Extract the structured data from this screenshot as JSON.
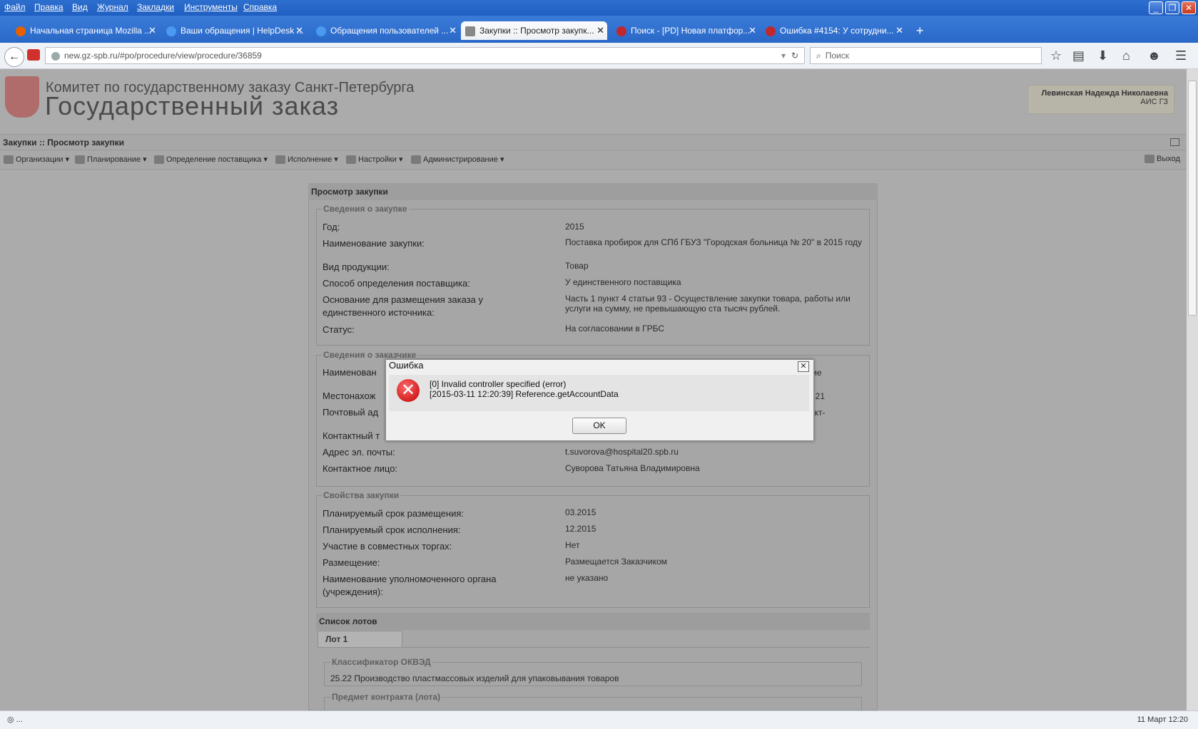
{
  "menu": [
    "Файл",
    "Правка",
    "Вид",
    "Журнал",
    "Закладки",
    "Инструменты",
    "Справка"
  ],
  "tabs": [
    {
      "label": "Начальная страница Mozilla ...",
      "icon": "firefox-icon",
      "color": "#e66000"
    },
    {
      "label": "Ваши обращения | HelpDesk ...",
      "icon": "help-icon",
      "color": "#2b7be0"
    },
    {
      "label": "Обращения пользователей ...",
      "icon": "help-icon",
      "color": "#2b7be0"
    },
    {
      "label": "Закупки :: Просмотр закупк...",
      "icon": "tools-icon",
      "color": "#777777"
    },
    {
      "label": "Поиск - [PD] Новая платфор...",
      "icon": "headset-icon",
      "color": "#c0282d"
    },
    {
      "label": "Ошибка #4154: У сотрудни...",
      "icon": "headset-icon",
      "color": "#c0282d"
    }
  ],
  "tab_close": "✕",
  "new_tab": "+",
  "url": "new.gz-spb.ru/#po/procedure/view/procedure/36859",
  "search_placeholder": "Поиск",
  "header": {
    "org": "Комитет по государственному заказу Санкт-Петербурга",
    "title": "Государственный заказ",
    "user_name": "Левинская Надежда Николаевна",
    "user_system": "АИС ГЗ"
  },
  "breadcrumb": "Закупки :: Просмотр закупки",
  "toolbar": [
    "Организации",
    "Планирование",
    "Определение поставщика",
    "Исполнение",
    "Настройки",
    "Администрирование"
  ],
  "logout": "Выход",
  "panel_title": "Просмотр закупки",
  "section1": {
    "legend": "Сведения о закупке",
    "rows": [
      {
        "label": "Год:",
        "value": "2015"
      },
      {
        "label": "Наименование закупки:",
        "value": "Поставка пробирок для СПб ГБУЗ \"Городская больница № 20\" в 2015 году"
      },
      {
        "label": "Вид продукции:",
        "value": "Товар"
      },
      {
        "label": "Способ определения поставщика:",
        "value": "У единственного поставщика"
      },
      {
        "label": "Основание для размещения заказа у единственного источника:",
        "value": "Часть 1 пункт 4 статьи 93 - Осуществление закупки товара, работы или услуги на сумму, не превышающую ста тысяч рублей."
      },
      {
        "label": "Статус:",
        "value": "На согласовании в ГРБС"
      }
    ]
  },
  "section2": {
    "legend": "Сведения о заказчике",
    "labels": [
      "Наименован",
      "Местонахож",
      "Почтовый ад",
      "Контактный т",
      "Адрес эл. почты:",
      "Контактное лицо:"
    ],
    "values": [
      "ение",
      ", 21",
      "нкт-",
      "",
      "t.suvorova@hospital20.spb.ru",
      "Суворова Татьяна Владимировна"
    ]
  },
  "section3": {
    "legend": "Свойства закупки",
    "rows": [
      {
        "label": "Планируемый срок размещения:",
        "value": "03.2015"
      },
      {
        "label": "Планируемый срок исполнения:",
        "value": "12.2015"
      },
      {
        "label": "Участие в совместных торгах:",
        "value": "Нет"
      },
      {
        "label": "Размещение:",
        "value": "Размещается Заказчиком"
      },
      {
        "label": "Наименование уполномоченного органа (учреждения):",
        "value": "не указано"
      }
    ]
  },
  "lots": {
    "title": "Список лотов",
    "tab": "Лот 1",
    "okved_legend": "Классификатор ОКВЭД",
    "okved_value": "25.22 Производство пластмассовых изделий для упаковывания товаров",
    "subject_legend": "Предмет контракта (лота)"
  },
  "dialog": {
    "title": "Ошибка",
    "close": "✕",
    "line1": "[0] Invalid controller specified (error)",
    "line2": "[2015-03-11 12:20:39] Reference.getAccountData",
    "ok": "OK"
  },
  "status": {
    "left": "...",
    "right": "11 Март 12:20"
  }
}
